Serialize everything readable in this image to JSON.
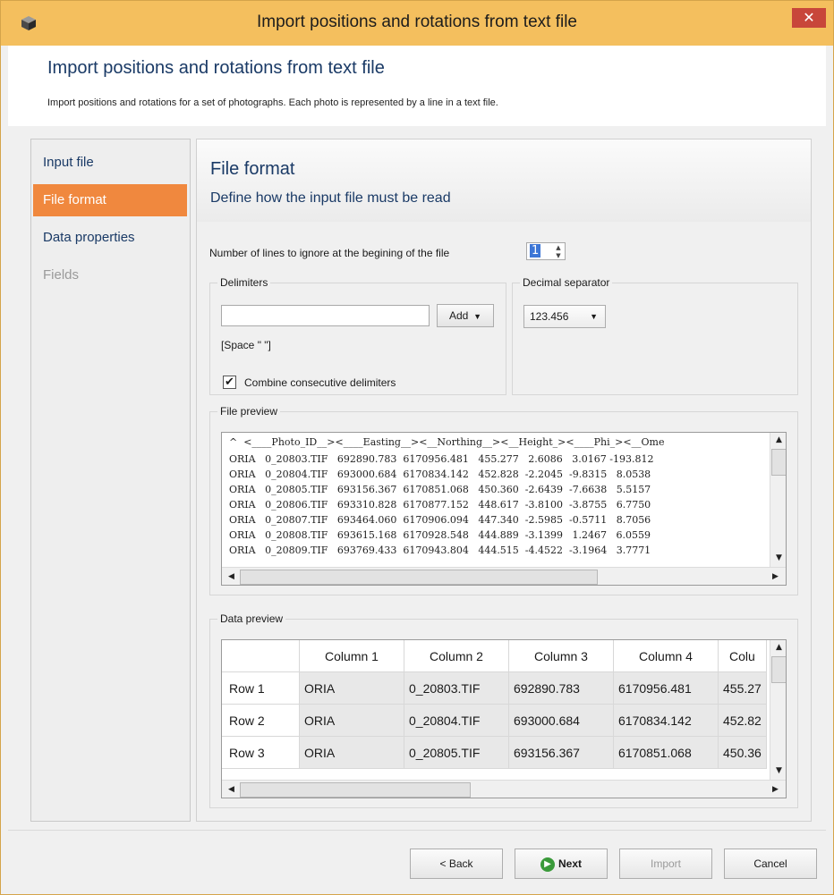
{
  "window": {
    "title": "Import positions and rotations from text file",
    "close_label": "✕"
  },
  "header": {
    "title": "Import positions and rotations from text file",
    "description": "Import positions and rotations for a set of photographs. Each photo is represented by a line in a text file."
  },
  "nav": {
    "items": [
      {
        "label": "Input file",
        "state": "normal"
      },
      {
        "label": "File format",
        "state": "active"
      },
      {
        "label": "Data properties",
        "state": "normal"
      },
      {
        "label": "Fields",
        "state": "disabled"
      }
    ]
  },
  "page": {
    "title": "File format",
    "subtitle": "Define how the input file must be read"
  },
  "ignore_lines": {
    "label": "Number of lines to ignore at the begining of the file",
    "value": "1"
  },
  "delimiters": {
    "legend": "Delimiters",
    "input_value": "",
    "add_label": "Add",
    "current": "[Space \" \"]",
    "combine_label": "Combine consecutive delimiters",
    "combine_checked": true
  },
  "decimal": {
    "legend": "Decimal separator",
    "value": "123.456"
  },
  "file_preview": {
    "legend": "File preview",
    "lines": [
      "^  <____Photo_ID__><____Easting__><__Northing__><__Height_><____Phi_><__Ome",
      "ORIA   0_20803.TIF   692890.783  6170956.481   455.277   2.6086   3.0167 -193.812",
      "ORIA   0_20804.TIF   693000.684  6170834.142   452.828  -2.2045  -9.8315   8.0538",
      "ORIA   0_20805.TIF   693156.367  6170851.068   450.360  -2.6439  -7.6638   5.5157",
      "ORIA   0_20806.TIF   693310.828  6170877.152   448.617  -3.8100  -3.8755   6.7750",
      "ORIA   0_20807.TIF   693464.060  6170906.094   447.340  -2.5985  -0.5711   8.7056",
      "ORIA   0_20808.TIF   693615.168  6170928.548   444.889  -3.1399   1.2467   6.0559",
      "ORIA   0_20809.TIF   693769.433  6170943.804   444.515  -4.4522  -3.1964   3.7771"
    ]
  },
  "data_preview": {
    "legend": "Data preview",
    "columns": [
      "Column 1",
      "Column 2",
      "Column 3",
      "Column 4",
      "Colu"
    ],
    "rows": [
      {
        "label": "Row 1",
        "cells": [
          "ORIA",
          "0_20803.TIF",
          "692890.783",
          "6170956.481",
          "455.27"
        ]
      },
      {
        "label": "Row 2",
        "cells": [
          "ORIA",
          "0_20804.TIF",
          "693000.684",
          "6170834.142",
          "452.82"
        ]
      },
      {
        "label": "Row 3",
        "cells": [
          "ORIA",
          "0_20805.TIF",
          "693156.367",
          "6170851.068",
          "450.36"
        ]
      }
    ]
  },
  "footer": {
    "back_label": "< Back",
    "next_label": "Next",
    "import_label": "Import",
    "cancel_label": "Cancel"
  },
  "colors": {
    "titlebar": "#f4bf5e",
    "nav_active": "#f0883e",
    "heading": "#1a3a66",
    "close": "#c8463a"
  }
}
